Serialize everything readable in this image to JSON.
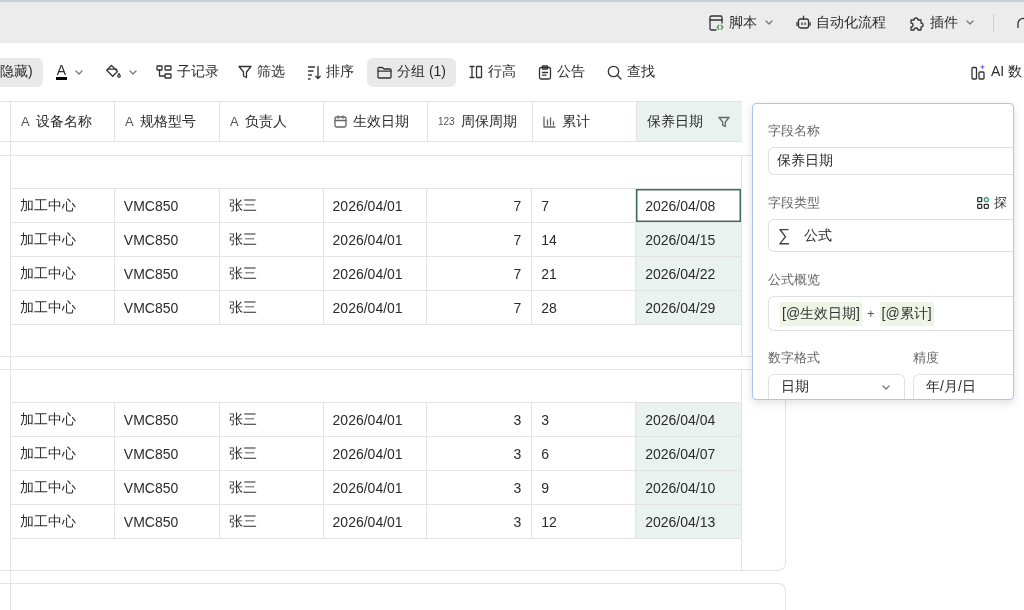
{
  "top_bar": {
    "items": [
      {
        "kind": "script",
        "label": "脚本",
        "has_menu": true
      },
      {
        "kind": "automation",
        "label": "自动化流程",
        "has_menu": false
      },
      {
        "kind": "plugin",
        "label": "插件",
        "has_menu": true
      }
    ]
  },
  "toolbar": {
    "items": [
      {
        "kind": "hidden",
        "label": "隐藏)",
        "active": true
      },
      {
        "kind": "text-color",
        "glyph": "A",
        "active": false
      },
      {
        "kind": "fill-color",
        "active": false
      },
      {
        "kind": "sub-record",
        "label": "子记录",
        "active": false
      },
      {
        "kind": "filter",
        "label": "筛选",
        "active": false
      },
      {
        "kind": "sort",
        "label": "排序",
        "active": false
      },
      {
        "kind": "group",
        "label": "分组 (1)",
        "active": true
      },
      {
        "kind": "row-height",
        "label": "行高",
        "active": false
      },
      {
        "kind": "notice",
        "label": "公告",
        "active": false
      },
      {
        "kind": "search",
        "label": "查找",
        "active": false
      },
      {
        "kind": "ai",
        "label": "AI 数",
        "active": false
      }
    ]
  },
  "table": {
    "columns": [
      {
        "kind": "text",
        "glyph": "A",
        "label": "设备名称",
        "selected": false,
        "filtered": false
      },
      {
        "kind": "text",
        "glyph": "A",
        "label": "规格型号",
        "selected": false,
        "filtered": false
      },
      {
        "kind": "text",
        "glyph": "A",
        "label": "负责人",
        "selected": false,
        "filtered": false
      },
      {
        "kind": "date",
        "label": "生效日期",
        "selected": false,
        "filtered": false
      },
      {
        "kind": "number",
        "glyph": "123",
        "label": "周保周期",
        "selected": false,
        "filtered": false
      },
      {
        "kind": "stat",
        "label": "累计",
        "selected": false,
        "filtered": false
      },
      {
        "kind": "formula",
        "label": "保养日期",
        "selected": true,
        "filtered": true
      }
    ],
    "groups": [
      {
        "rows": [
          {
            "selected": true,
            "cells": [
              "加工中心",
              "VMC850",
              "张三",
              "2026/04/01",
              "7",
              "7",
              "2026/04/08"
            ]
          },
          {
            "selected": false,
            "cells": [
              "加工中心",
              "VMC850",
              "张三",
              "2026/04/01",
              "7",
              "14",
              "2026/04/15"
            ]
          },
          {
            "selected": false,
            "cells": [
              "加工中心",
              "VMC850",
              "张三",
              "2026/04/01",
              "7",
              "21",
              "2026/04/22"
            ]
          },
          {
            "selected": false,
            "cells": [
              "加工中心",
              "VMC850",
              "张三",
              "2026/04/01",
              "7",
              "28",
              "2026/04/29"
            ]
          }
        ]
      },
      {
        "rows": [
          {
            "selected": false,
            "cells": [
              "加工中心",
              "VMC850",
              "张三",
              "2026/04/01",
              "3",
              "3",
              "2026/04/04"
            ]
          },
          {
            "selected": false,
            "cells": [
              "加工中心",
              "VMC850",
              "张三",
              "2026/04/01",
              "3",
              "6",
              "2026/04/07"
            ]
          },
          {
            "selected": false,
            "cells": [
              "加工中心",
              "VMC850",
              "张三",
              "2026/04/01",
              "3",
              "9",
              "2026/04/10"
            ]
          },
          {
            "selected": false,
            "cells": [
              "加工中心",
              "VMC850",
              "张三",
              "2026/04/01",
              "3",
              "12",
              "2026/04/13"
            ]
          }
        ]
      }
    ]
  },
  "field_panel": {
    "name_label": "字段名称",
    "name_value": "保养日期",
    "type_label": "字段类型",
    "explore_label": "探",
    "type_symbol": "∑",
    "type_value": "公式",
    "formula_label": "公式概览",
    "formula_tokens": [
      {
        "kind": "field",
        "text": "[@生效日期]"
      },
      {
        "kind": "operator",
        "text": "+"
      },
      {
        "kind": "field",
        "text": "[@累计]"
      }
    ],
    "format_label": "数字格式",
    "format_value": "日期",
    "precision_label": "精度",
    "precision_value": "年/月/日"
  }
}
